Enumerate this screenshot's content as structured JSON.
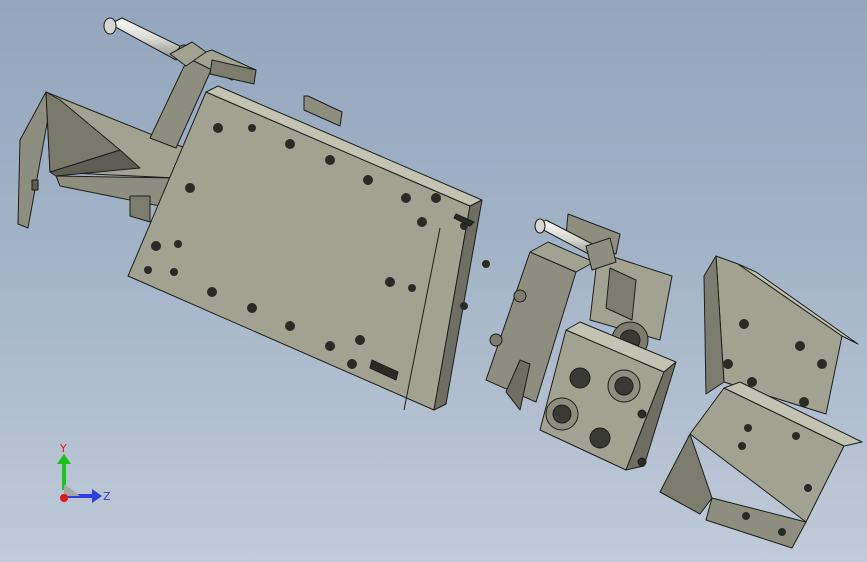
{
  "viewport": {
    "background_top": "#93a6bd",
    "background_bottom": "#c0cad8"
  },
  "model": {
    "face_color": "#a2a292",
    "shade_color": "#7d7d6f",
    "edge_color": "#1e1e1a",
    "rod_color": "#e4e4e0"
  },
  "triad": {
    "y_label": "Y",
    "z_label": "Z",
    "y_color": "#19c319",
    "z_color": "#2a40e0",
    "x_color": "#e01919"
  }
}
